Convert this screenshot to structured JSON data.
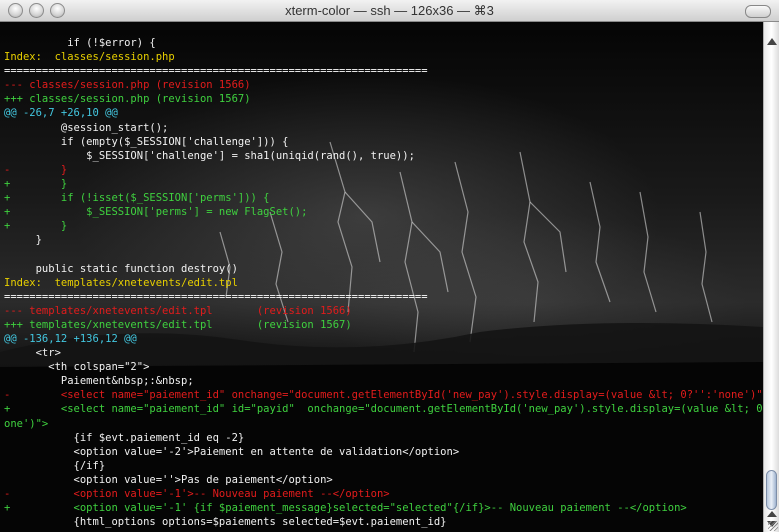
{
  "window": {
    "title": "xterm-color — ssh — 126x36 — ⌘3"
  },
  "terminal": {
    "lines": [
      {
        "text": "          if (!$error) {",
        "color": "default"
      },
      {
        "text": "Index:  classes/session.php",
        "color": "yellow"
      },
      {
        "text": "===================================================================",
        "color": "white"
      },
      {
        "text": "--- classes/session.php (revision 1566)",
        "color": "red"
      },
      {
        "text": "+++ classes/session.php (revision 1567)",
        "color": "green"
      },
      {
        "text": "@@ -26,7 +26,10 @@",
        "color": "cyan"
      },
      {
        "text": "         @session_start();",
        "color": "default"
      },
      {
        "text": "         if (empty($_SESSION['challenge'])) {",
        "color": "default"
      },
      {
        "text": "             $_SESSION['challenge'] = sha1(uniqid(rand(), true));",
        "color": "default"
      },
      {
        "text": "-        }",
        "color": "red"
      },
      {
        "text": "+        }",
        "color": "green"
      },
      {
        "text": "+        if (!isset($_SESSION['perms'])) {",
        "color": "green"
      },
      {
        "text": "+            $_SESSION['perms'] = new FlagSet();",
        "color": "green"
      },
      {
        "text": "+        }",
        "color": "green"
      },
      {
        "text": "     }",
        "color": "default"
      },
      {
        "text": "",
        "color": "default"
      },
      {
        "text": "     public static function destroy()",
        "color": "default"
      },
      {
        "text": "Index:  templates/xnetevents/edit.tpl",
        "color": "yellow"
      },
      {
        "text": "===================================================================",
        "color": "white"
      },
      {
        "text": "--- templates/xnetevents/edit.tpl       (revision 1566)",
        "color": "red"
      },
      {
        "text": "+++ templates/xnetevents/edit.tpl       (revision 1567)",
        "color": "green"
      },
      {
        "text": "@@ -136,12 +136,12 @@",
        "color": "cyan"
      },
      {
        "text": "     <tr>",
        "color": "default"
      },
      {
        "text": "       <th colspan=\"2\">",
        "color": "default"
      },
      {
        "text": "         Paiement&nbsp;:&nbsp;",
        "color": "default"
      },
      {
        "text": "-        <select name=\"paiement_id\" onchange=\"document.getElementById('new_pay').style.display=(value &lt; 0?'':'none')\">",
        "color": "red"
      },
      {
        "text": "+        <select name=\"paiement_id\" id=\"payid\"  onchange=\"document.getElementById('new_pay').style.display=(value &lt; 0?'':'n",
        "color": "green"
      },
      {
        "text": "one')\">",
        "color": "green"
      },
      {
        "text": "           {if $evt.paiement_id eq -2}",
        "color": "default"
      },
      {
        "text": "           <option value='-2'>Paiement en attente de validation</option>",
        "color": "default"
      },
      {
        "text": "           {/if}",
        "color": "default"
      },
      {
        "text": "           <option value=''>Pas de paiement</option>",
        "color": "default"
      },
      {
        "text": "-          <option value='-1'>-- Nouveau paiement --</option>",
        "color": "red"
      },
      {
        "text": "+          <option value='-1' {if $paiement_message}selected=\"selected\"{/if}>-- Nouveau paiement --</option>",
        "color": "green"
      },
      {
        "text": "           {html_options options=$paiements selected=$evt.paiement_id}",
        "color": "default"
      }
    ]
  },
  "colors": {
    "default": "#f2f2f2",
    "yellow": "#e8d000",
    "green": "#3fd13f",
    "red": "#e31c1c",
    "cyan": "#43c7e0",
    "white": "#ffffff"
  }
}
